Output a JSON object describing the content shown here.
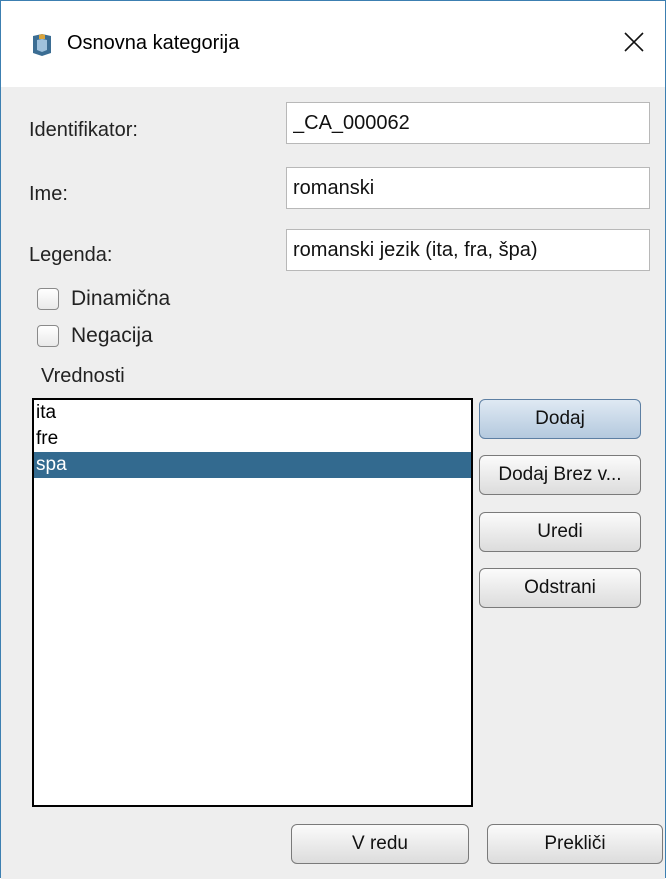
{
  "window": {
    "title": "Osnovna kategorija",
    "icon": "app-icon",
    "close_icon": "close-icon"
  },
  "form": {
    "identifier": {
      "label": "Identifikator:",
      "value": "_CA_000062"
    },
    "name": {
      "label": "Ime:",
      "value": "romanski"
    },
    "legend": {
      "label": "Legenda:",
      "value": "romanski jezik (ita, fra, špa)"
    },
    "dynamic": {
      "label": "Dinamična",
      "checked": false
    },
    "negation": {
      "label": "Negacija",
      "checked": false
    }
  },
  "values": {
    "label": "Vrednosti",
    "items": [
      {
        "text": "ita",
        "selected": false
      },
      {
        "text": "fre",
        "selected": false
      },
      {
        "text": "spa",
        "selected": true
      }
    ],
    "selection_color": "#336a8f"
  },
  "side_buttons": {
    "add": "Dodaj",
    "add_without": "Dodaj Brez v...",
    "edit": "Uredi",
    "remove": "Odstrani"
  },
  "footer": {
    "ok": "V redu",
    "cancel": "Prekliči"
  },
  "colors": {
    "window_border": "#3c7fb1",
    "background": "#eeeeee",
    "primary_button": "#b4c9de"
  }
}
